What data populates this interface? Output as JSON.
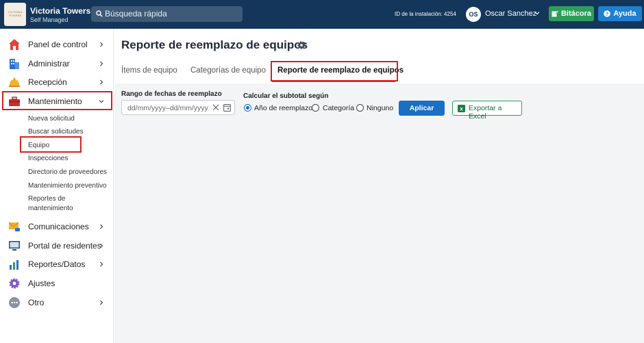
{
  "brand": {
    "name": "Victoria Towers",
    "subtitle": "Self Managed",
    "logo_text": "VICTORIA TOWERS"
  },
  "search": {
    "placeholder": "Búsqueda rápida"
  },
  "header": {
    "install_id": "ID de la instalación: 4254",
    "avatar_initials": "OS",
    "user_name": "Oscar Sanchez",
    "bitacora_label": "Bitácora",
    "ayuda_label": "Ayuda"
  },
  "sidebar": {
    "items": [
      {
        "label": "Panel de control",
        "icon": "home-icon"
      },
      {
        "label": "Administrar",
        "icon": "building-icon"
      },
      {
        "label": "Recepción",
        "icon": "bell-icon"
      },
      {
        "label": "Mantenimiento",
        "icon": "toolbox-icon"
      },
      {
        "label": "Comunicaciones",
        "icon": "envelope-icon"
      },
      {
        "label": "Portal de residentes",
        "icon": "monitor-icon"
      },
      {
        "label": "Reportes/Datos",
        "icon": "bar-chart-icon"
      },
      {
        "label": "Ajustes",
        "icon": "gear-icon"
      },
      {
        "label": "Otro",
        "icon": "more-icon"
      }
    ],
    "subitems": [
      "Nueva solicitud",
      "Buscar solicitudes",
      "Equipo",
      "Inspecciones",
      "Directorio de proveedores",
      "Mantenimiento preventivo",
      "Reportes de",
      "mantenimiento"
    ]
  },
  "main": {
    "title": "Reporte de reemplazo de equipos",
    "tabs": [
      "Ítems de equipo",
      "Categorías de equipo",
      "Reporte de reemplazo de equipos"
    ],
    "date_range_label": "Rango de fechas de reemplazo",
    "date_placeholder": "dd/mm/yyyy–dd/mm/yyyy",
    "subtotal_label": "Calcular el subtotal según",
    "radio_options": [
      "Año de reemplazo",
      "Categoría",
      "Ninguno"
    ],
    "selected_option": "Año de reemplazo",
    "apply_label": "Aplicar",
    "export_label": "Exportar a Excel"
  },
  "colors": {
    "topbar": "#14365a",
    "accent": "#1a6fc4",
    "green": "#2e9d5a",
    "highlight": "#d61f26"
  }
}
